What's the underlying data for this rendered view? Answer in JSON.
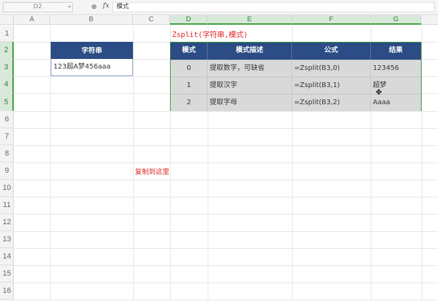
{
  "formula_bar": {
    "name_box": "D2",
    "formula": "模式",
    "fx_label": "fx"
  },
  "columns": [
    "A",
    "B",
    "C",
    "D",
    "E",
    "F",
    "G"
  ],
  "rows": [
    "1",
    "2",
    "3",
    "4",
    "5",
    "6",
    "7",
    "8",
    "9",
    "10",
    "11",
    "12",
    "13",
    "14",
    "15",
    "16"
  ],
  "source_table": {
    "header": "字符串",
    "value": "123超A梦456aaa"
  },
  "notes": {
    "function_hint": "Zsplit(字符串,模式)",
    "copy_hint": "复制到这里"
  },
  "main_table": {
    "headers": [
      "模式",
      "模式描述",
      "公式",
      "结果"
    ],
    "rows": [
      [
        "0",
        "提取数字，可缺省",
        "=Zsplit(B3,0)",
        "123456"
      ],
      [
        "1",
        "提取汉字",
        "=Zsplit(B3,1)",
        "超梦"
      ],
      [
        "2",
        "提取字母",
        "=Zsplit(B3,2)",
        "Aaaa"
      ]
    ]
  },
  "colors": {
    "header_fill": "#2b4c84",
    "selection_green": "#3a9a3a",
    "note_red": "#e02a2a",
    "body_fill": "#d9d9d9"
  },
  "icons": [
    "zoom-icon",
    "fx-icon",
    "dropdown-icon",
    "cell-cursor-icon"
  ]
}
